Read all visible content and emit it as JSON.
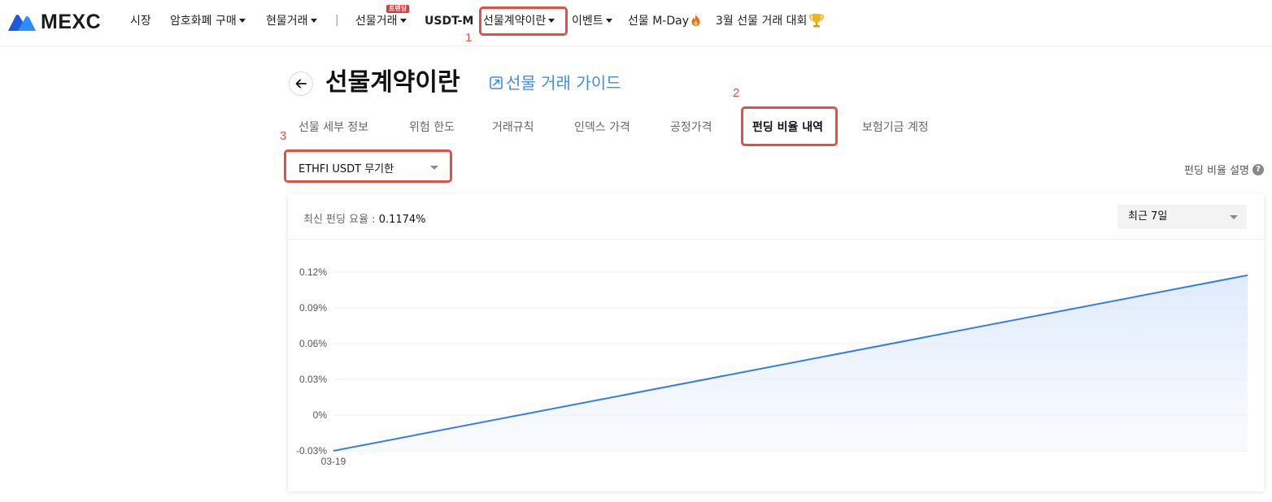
{
  "nav": {
    "brand": "MEXC",
    "items": [
      {
        "label": "시장",
        "caret": false
      },
      {
        "label": "암호화폐 구매",
        "caret": true
      },
      {
        "label": "현물거래",
        "caret": true
      },
      {
        "label": "선물거래",
        "caret": true,
        "badge": "트렌딩"
      },
      {
        "label": "USDT-M",
        "caret": false
      },
      {
        "label": "선물계약이란",
        "caret": true
      },
      {
        "label": "이벤트",
        "caret": true
      },
      {
        "label": "선물 M-Day",
        "caret": false,
        "icon": "fire-icon"
      },
      {
        "label": "3월 선물 거래 대회",
        "caret": false,
        "icon": "trophy-icon"
      }
    ],
    "separator": "|"
  },
  "annotations": [
    "1",
    "2",
    "3"
  ],
  "header": {
    "title": "선물계약이란",
    "guide_link": "선물 거래 가이드"
  },
  "tabs": [
    {
      "label": "선물 세부 정보",
      "active": false
    },
    {
      "label": "위험 한도",
      "active": false
    },
    {
      "label": "거래규칙",
      "active": false
    },
    {
      "label": "인덱스 가격",
      "active": false
    },
    {
      "label": "공정가격",
      "active": false
    },
    {
      "label": "펀딩 비율 내역",
      "active": true
    },
    {
      "label": "보험기금 계정",
      "active": false
    }
  ],
  "contract_select": {
    "value": "ETHFI USDT 무기한"
  },
  "funding_help": {
    "label": "펀딩 비율 설명",
    "icon": "?"
  },
  "card": {
    "latest_label": "최신 펀딩 요율 :",
    "latest_value": "0.1174%",
    "range_select": "최근 7일"
  },
  "colors": {
    "accent": "#3f8ee8",
    "line": "#3a7bdf",
    "annotation": "#e0504a"
  },
  "chart_data": {
    "type": "area",
    "x": [
      "03-19",
      "latest"
    ],
    "values": [
      -0.03,
      0.1174
    ],
    "x_tick_labels": [
      "03-19"
    ],
    "y_tick_labels": [
      "0.12%",
      "0.09%",
      "0.06%",
      "0.03%",
      "0%",
      "-0.03%"
    ],
    "y_ticks": [
      0.12,
      0.09,
      0.06,
      0.03,
      0,
      -0.03
    ],
    "ylim": [
      -0.03,
      0.12
    ],
    "grid": true
  }
}
